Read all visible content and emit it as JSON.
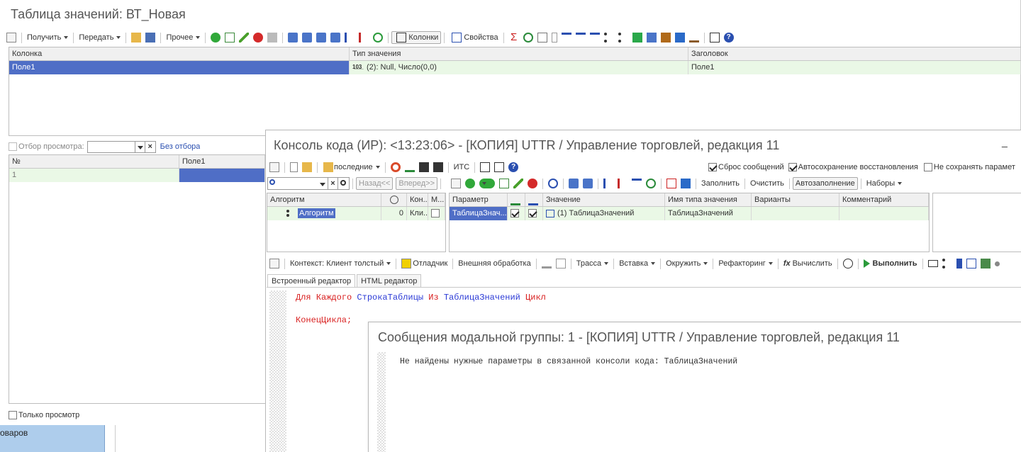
{
  "bg_window": {
    "title": "Таблица значений: ВТ_Новая",
    "toolbar": {
      "get": "Получить",
      "send": "Передать",
      "other": "Прочее",
      "columns": "Колонки",
      "properties": "Свойства"
    },
    "columns_table": {
      "headers": [
        "Колонка",
        "Тип значения",
        "Заголовок"
      ],
      "row": {
        "name": "Поле1",
        "type": "(2): Null, Число(0,0)",
        "title": "Поле1"
      }
    },
    "filter": {
      "label": "Отбор просмотра:",
      "no_filter": "Без отбора"
    },
    "data_table": {
      "headers": [
        "№",
        "Поле1"
      ],
      "row": {
        "num": "1"
      }
    },
    "readonly_label": "Только просмотр",
    "side_text": "оваров"
  },
  "console": {
    "title": "Консоль кода (ИР): <13:23:06> - [КОПИЯ] UTTR / Управление торговлей, редакция 11",
    "minimize": "_",
    "toolbar1": {
      "recent": "последние",
      "its": "ИТС",
      "reset_messages": "Сброс сообщений",
      "autosave": "Автосохранение восстановления",
      "no_save": "Не сохранять парамет"
    },
    "toolbar2": {
      "back": "Назад<<",
      "forward": "Вперед>>",
      "fill": "Заполнить",
      "clear": "Очистить",
      "autofill": "Автозаполнение",
      "sets": "Наборы"
    },
    "algo_table": {
      "headers": [
        "Алгоритм",
        "Кон...",
        "М..."
      ],
      "row": {
        "name": "Алгоритм",
        "num": "0",
        "ctx": "Кли..."
      }
    },
    "param_table": {
      "headers": [
        "Параметр",
        "Значение",
        "Имя типа значения",
        "Варианты",
        "Комментарий"
      ],
      "row": {
        "name": "ТаблицаЗнач...",
        "value": "(1) ТаблицаЗначений",
        "type_name": "ТаблицаЗначений"
      }
    },
    "toolbar3": {
      "context": "Контекст: Клиент толстый",
      "debugger": "Отладчик",
      "ext": "Внешняя обработка",
      "trace": "Трасса",
      "insert": "Вставка",
      "surround": "Окружить",
      "refactor": "Рефакторинг",
      "calc": "Вычислить",
      "run": "Выполнить"
    },
    "tabs": [
      "Встроенный редактор",
      "HTML редактор"
    ],
    "code": {
      "line1": [
        {
          "t": "Для ",
          "c": "#d81e1e"
        },
        {
          "t": "Каждого ",
          "c": "#d81e1e"
        },
        {
          "t": "СтрокаТаблицы ",
          "c": "#2b3ad6"
        },
        {
          "t": "Из ",
          "c": "#d81e1e"
        },
        {
          "t": "ТаблицаЗначений ",
          "c": "#2b3ad6"
        },
        {
          "t": "Цикл",
          "c": "#d81e1e"
        }
      ],
      "line2": "КонецЦикла;"
    }
  },
  "modal": {
    "title": "Сообщения модальной группы: 1 - [КОПИЯ] UTTR / Управление торговлей, редакция 11",
    "message": "Не найдены нужные параметры в связанной консоли кода: ТаблицаЗначений"
  },
  "colors": {
    "selection": "#4f6ec6",
    "green_row": "#eaf8e6",
    "keyword": "#d81e1e",
    "identifier": "#2b3ad6"
  }
}
